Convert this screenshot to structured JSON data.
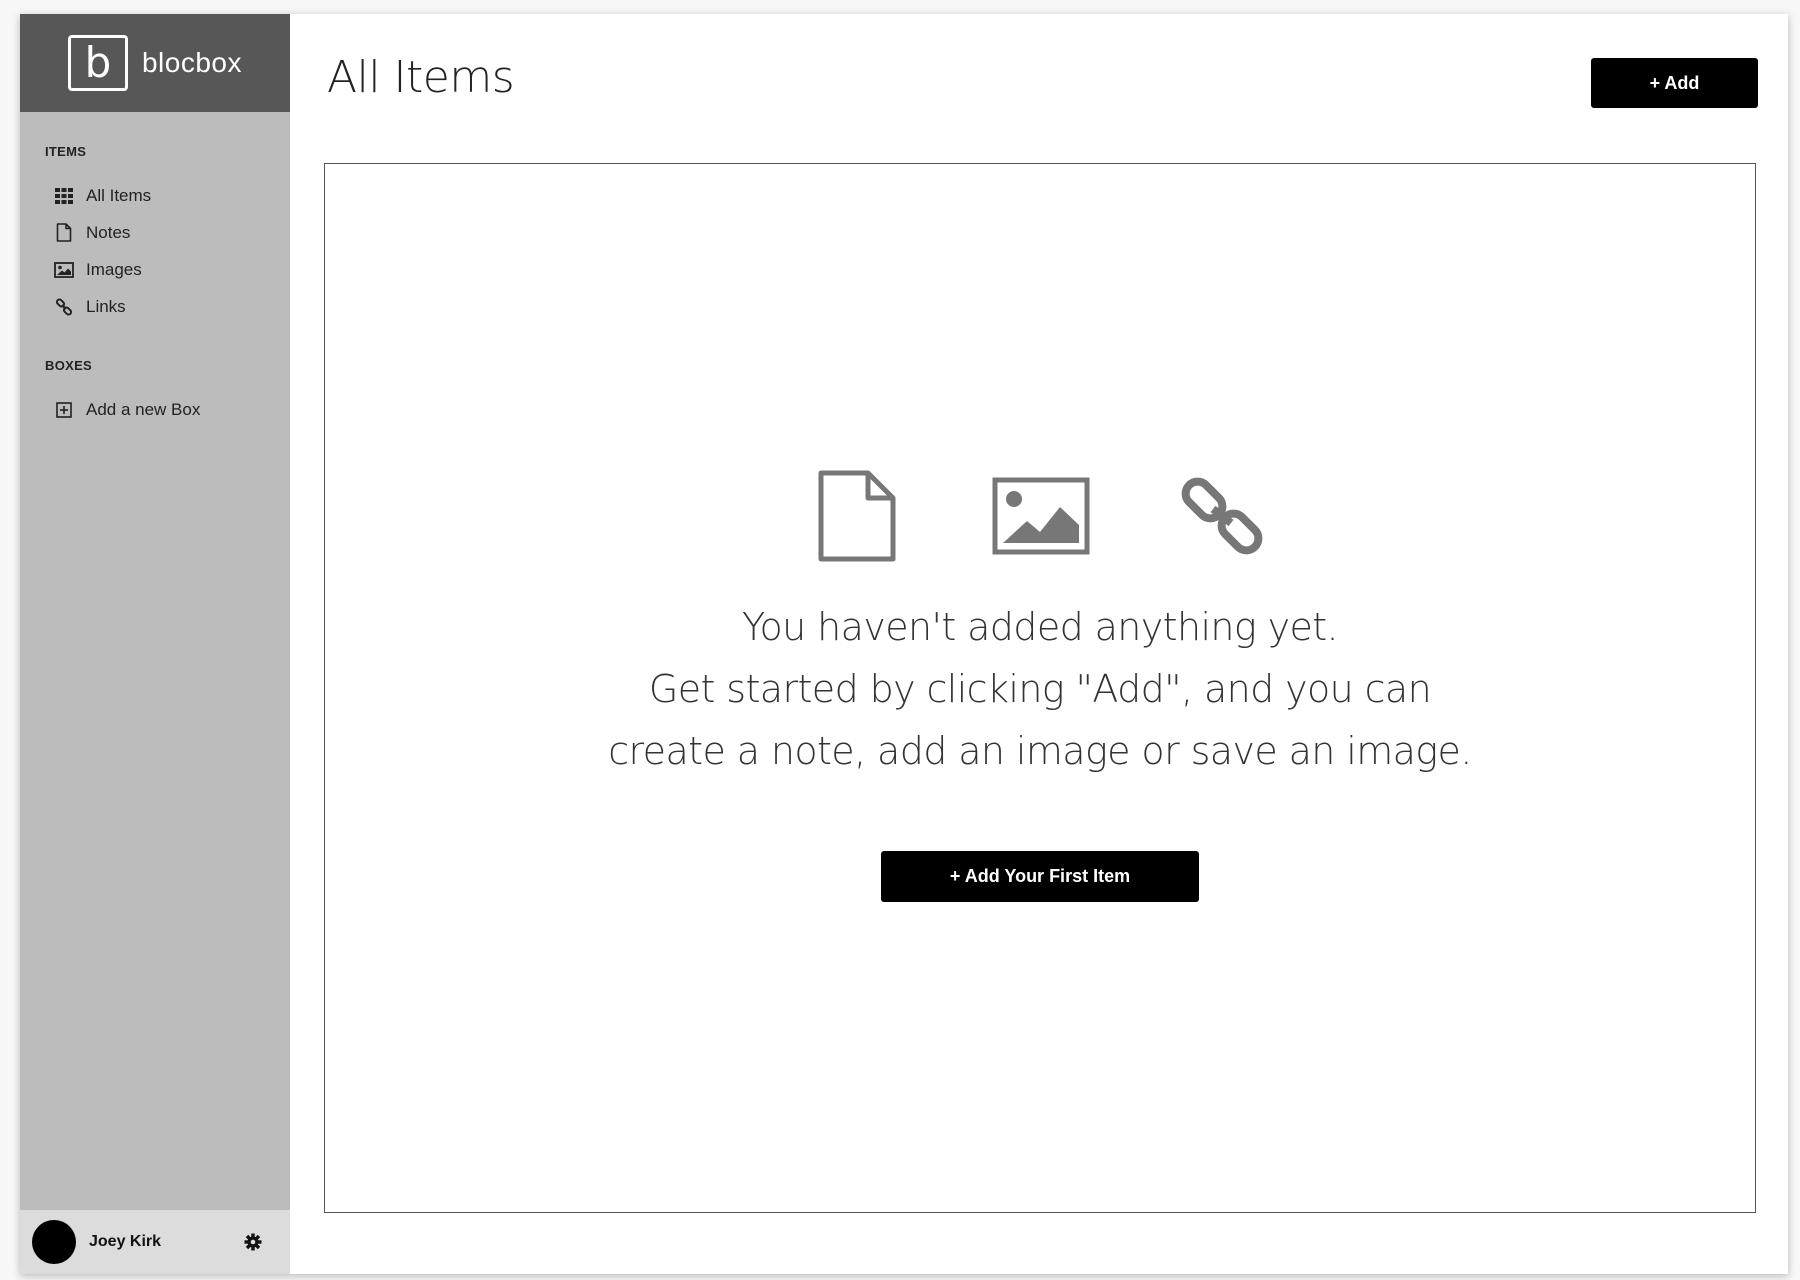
{
  "brand": {
    "logo_letter": "b",
    "name": "blocbox"
  },
  "sidebar": {
    "items_title": "ITEMS",
    "items": [
      {
        "label": "All Items",
        "icon": "grid-icon"
      },
      {
        "label": "Notes",
        "icon": "file-icon"
      },
      {
        "label": "Images",
        "icon": "image-icon"
      },
      {
        "label": "Links",
        "icon": "link-icon"
      }
    ],
    "boxes_title": "BOXES",
    "boxes": [
      {
        "label": "Add a new Box",
        "icon": "plus-square-icon"
      }
    ]
  },
  "user": {
    "name": "Joey Kirk"
  },
  "header": {
    "title": "All Items",
    "add_label": "+ Add"
  },
  "empty_state": {
    "line1": "You haven't added anything yet.",
    "line2": "Get started by clicking \"Add\", and you can",
    "line3": "create a note, add an image or save an image.",
    "button_label": "+ Add Your First Item"
  },
  "colors": {
    "sidebar_bg": "#bcbcbc",
    "brand_bg": "#575757",
    "user_bar_bg": "#dcdcdc",
    "button_bg": "#000000",
    "icon_gray": "#777777"
  }
}
